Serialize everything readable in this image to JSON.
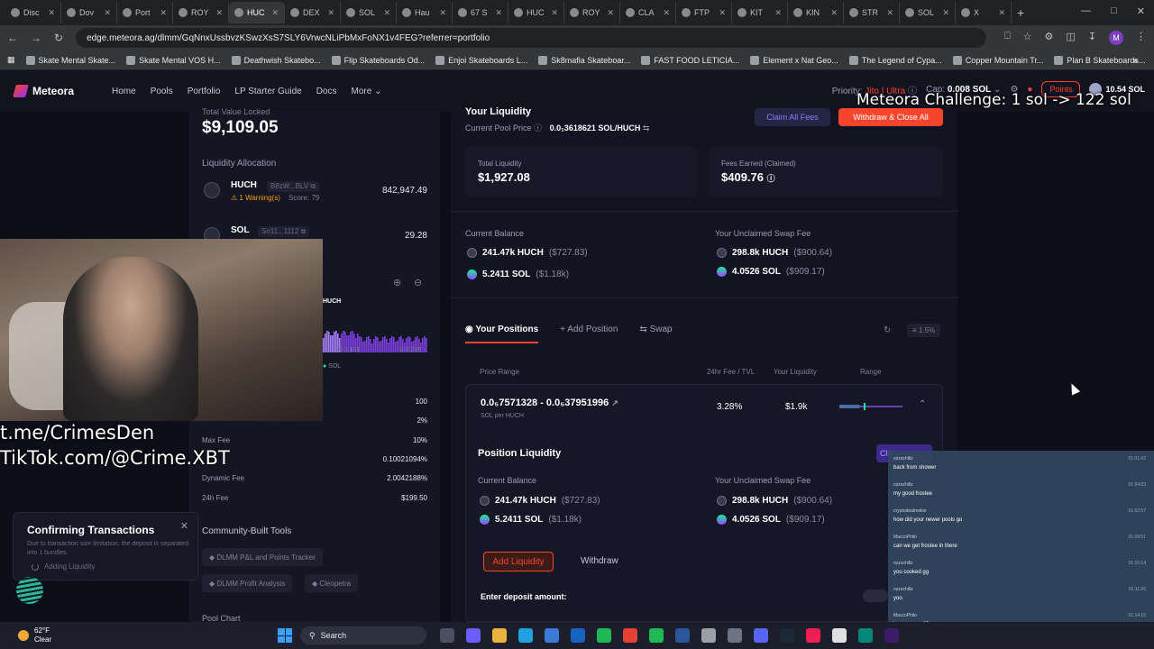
{
  "browser": {
    "tabs": [
      {
        "label": "Disc"
      },
      {
        "label": "Dov"
      },
      {
        "label": "Port"
      },
      {
        "label": "ROY"
      },
      {
        "label": "HUC",
        "active": true
      },
      {
        "label": "DEX"
      },
      {
        "label": "SOL"
      },
      {
        "label": "Hau"
      },
      {
        "label": "67 S"
      },
      {
        "label": "HUC"
      },
      {
        "label": "ROY"
      },
      {
        "label": "CLA"
      },
      {
        "label": "FTP"
      },
      {
        "label": "KIT"
      },
      {
        "label": "KIN"
      },
      {
        "label": "STR"
      },
      {
        "label": "SOL"
      },
      {
        "label": "X"
      }
    ],
    "url": "edge.meteora.ag/dlmm/GqNnxUssbvzKSwzXsS7SLY6VrwcNLiPbMxFoNX1v4FEG?referrer=portfolio",
    "profile_initial": "M",
    "bookmarks": [
      "Skate Mental Skate...",
      "Skate Mental VOS H...",
      "Deathwish Skatebo...",
      "Flip Skateboards Od...",
      "Enjoi Skateboards L...",
      "Sk8mafia Skateboar...",
      "FAST FOOD LETICIA...",
      "Element x Nat Geo...",
      "The Legend of Cypa...",
      "Copper Mountain Tr...",
      "Plan B Skateboards..."
    ]
  },
  "header": {
    "brand": "Meteora",
    "nav": [
      "Home",
      "Pools",
      "Portfolio",
      "LP Starter Guide",
      "Docs",
      "More"
    ],
    "priority_label": "Priority:",
    "priority_value": "Jito | Ultra",
    "cap_label": "Cap:",
    "cap_value": "0.008 SOL",
    "points_label": "Points",
    "wallet_balance": "10.54 SOL"
  },
  "stream_overlay": {
    "challenge": "Meteora Challenge: 1 sol -> 122 sol",
    "telegram": "t.me/CrimesDen",
    "tiktok": "TikTok.com/@Crime.XBT"
  },
  "left_panel": {
    "tvl_label": "Total Value Locked",
    "tvl_value": "$9,109.05",
    "allocation_label": "Liquidity Allocation",
    "tokens": [
      {
        "name": "HUCH",
        "address": "B8zW...BLV",
        "warning": "1 Warning(s)",
        "score": "Score: 79",
        "amount": "842,947.49"
      },
      {
        "name": "SOL",
        "address": "So11...1112",
        "amount": "29.28"
      }
    ],
    "chart_label": "HUCH",
    "chart_ticks": [
      "0.0.161",
      "0.0.226"
    ],
    "chart_legend": "SOL",
    "stats": [
      {
        "label": "",
        "value": "100"
      },
      {
        "label": "",
        "value": "2%"
      },
      {
        "label": "Max Fee",
        "value": "10%"
      },
      {
        "label": "",
        "value": "0.10021094%"
      },
      {
        "label": "Dynamic Fee",
        "value": "2.0042188%"
      },
      {
        "label": "24h Fee",
        "value": "$199.50"
      }
    ],
    "tools_label": "Community-Built Tools",
    "tools": [
      "DLMM P&L and Points Tracker",
      "DLMM Profit Analysis",
      "Cleopetra"
    ],
    "pool_chart_label": "Pool Chart"
  },
  "liquidity": {
    "title": "Your Liquidity",
    "pool_price_label": "Current Pool Price",
    "pool_price_value": "0.0₁₁3618621 SOL/HUCH",
    "pool_price_display": "0.0₁3618621 SOL/HUCH",
    "claim_all_label": "Claim All Fees",
    "withdraw_all_label": "Withdraw & Close All",
    "total_liquidity_label": "Total Liquidity",
    "total_liquidity_value": "$1,927.08",
    "fees_earned_label": "Fees Earned (Claimed)",
    "fees_earned_value": "$409.76",
    "current_balance_label": "Current Balance",
    "current_balance": [
      {
        "amount": "241.47k HUCH",
        "usd": "($727.83)"
      },
      {
        "amount": "5.2411 SOL",
        "usd": "($1.18k)"
      }
    ],
    "unclaimed_label": "Your Unclaimed Swap Fee",
    "unclaimed": [
      {
        "amount": "298.8k HUCH",
        "usd": "($900.64)"
      },
      {
        "amount": "4.0526 SOL",
        "usd": "($909.17)"
      }
    ]
  },
  "positions": {
    "tabs": [
      "Your Positions",
      "Add Position",
      "Swap"
    ],
    "slippage": "1.5%",
    "columns": [
      "Price Range",
      "24hr Fee / TVL",
      "Your Liquidity",
      "Range"
    ],
    "row": {
      "range": "0.0₅7571328 - 0.0₅3795199 6",
      "range_display": "0.0₅7571328 - 0.0₅37951996",
      "unit": "SOL per HUCH",
      "fee_tvl": "3.28%",
      "liquidity": "$1.9k",
      "in_range": 0.4
    },
    "detail": {
      "title": "Position Liquidity",
      "claim_label": "Cla",
      "current_balance_label": "Current Balance",
      "current_balance": [
        {
          "amount": "241.47k HUCH",
          "usd": "($727.83)"
        },
        {
          "amount": "5.2411 SOL",
          "usd": "($1.18k)"
        }
      ],
      "unclaimed_label": "Your Unclaimed Swap Fee",
      "unclaimed": [
        {
          "amount": "298.8k HUCH",
          "usd": "($900.64)"
        },
        {
          "amount": "4.0526 SOL",
          "usd": "($909.17)"
        }
      ],
      "add_liquidity_label": "Add Liquidity",
      "withdraw_label": "Withdraw",
      "deposit_label": "Enter deposit amount:"
    }
  },
  "toast": {
    "title": "Confirming Transactions",
    "description": "Due to transaction size limitation, the deposit is separated into 1 bundles.",
    "status": "Adding Liquidity"
  },
  "chat": [
    {
      "user": "ozzochillz",
      "time": "01:01:42",
      "text": "back from shower"
    },
    {
      "user": "ozzochillz",
      "time": "01:04:03",
      "text": "my good frostee"
    },
    {
      "user": "cryptodealmaker",
      "time": "01:02:57",
      "text": "how did your newer pools go"
    },
    {
      "user": "MaccoPhilo",
      "time": "01:09:51",
      "text": "can we get frostee in there"
    },
    {
      "user": "ozzochillz",
      "time": "01:10:14",
      "text": "you cooked gg"
    },
    {
      "user": "ozzochillz",
      "time": "01:11:26",
      "text": "yoo"
    },
    {
      "user": "MaccoPhilo",
      "time": "01:14:15",
      "text": "i got you on 2D screens rn"
    },
    {
      "user": "MaccoPhilo",
      "time": "",
      "text": ""
    }
  ],
  "taskbar": {
    "temperature": "62°F",
    "weather": "Clear",
    "search": "Search"
  }
}
